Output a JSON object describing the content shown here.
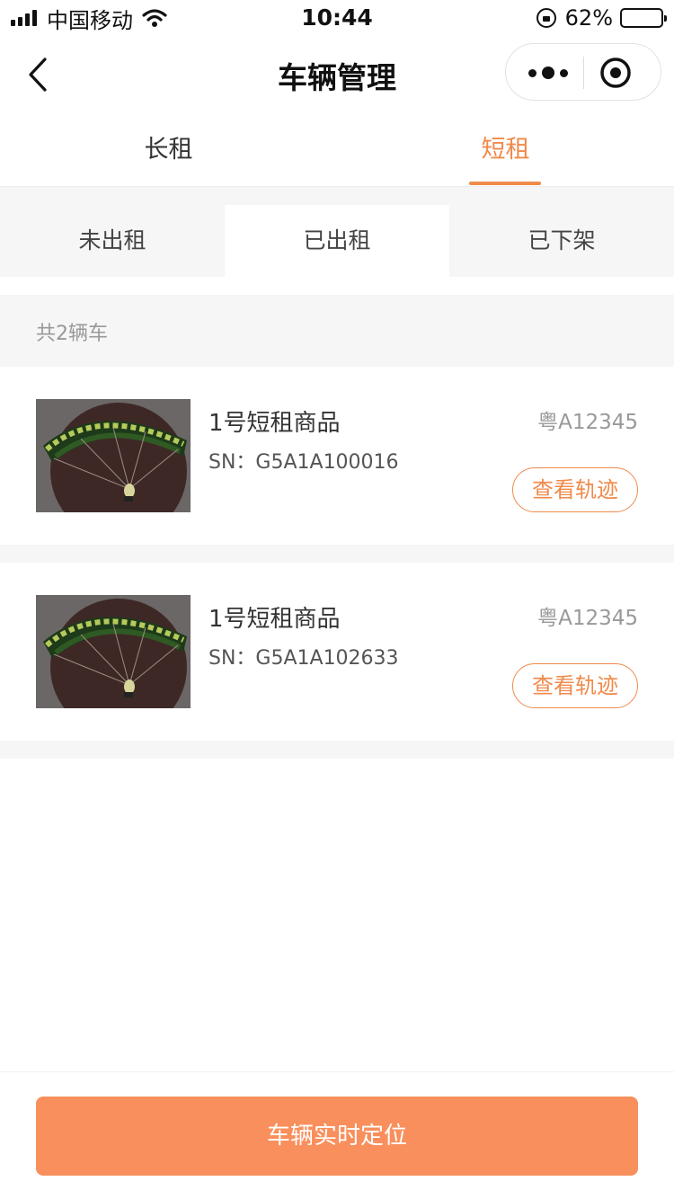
{
  "status_bar": {
    "carrier": "中国移动",
    "time": "10:44",
    "battery_percent": "62%",
    "battery_level": 0.62,
    "icons": [
      "signal-icon",
      "wifi-icon",
      "orientation-lock-icon",
      "battery-icon"
    ]
  },
  "nav": {
    "title": "车辆管理",
    "icons": [
      "back-icon",
      "more-icon",
      "close-target-icon"
    ]
  },
  "main_tabs": [
    {
      "label": "长租",
      "active": false
    },
    {
      "label": "短租",
      "active": true
    }
  ],
  "sub_tabs": [
    {
      "label": "未出租",
      "active": false
    },
    {
      "label": "已出租",
      "active": true
    },
    {
      "label": "已下架",
      "active": false
    }
  ],
  "count_text": "共2辆车",
  "vehicles": [
    {
      "name": "1号短租商品",
      "sn": "SN：G5A1A100016",
      "plate": "粤A12345",
      "action": "查看轨迹"
    },
    {
      "name": "1号短租商品",
      "sn": "SN：G5A1A102633",
      "plate": "粤A12345",
      "action": "查看轨迹"
    }
  ],
  "bottom_button": "车辆实时定位",
  "colors": {
    "accent": "#f08a4b",
    "button": "#f98f5c",
    "section_bg": "#f6f6f6"
  }
}
